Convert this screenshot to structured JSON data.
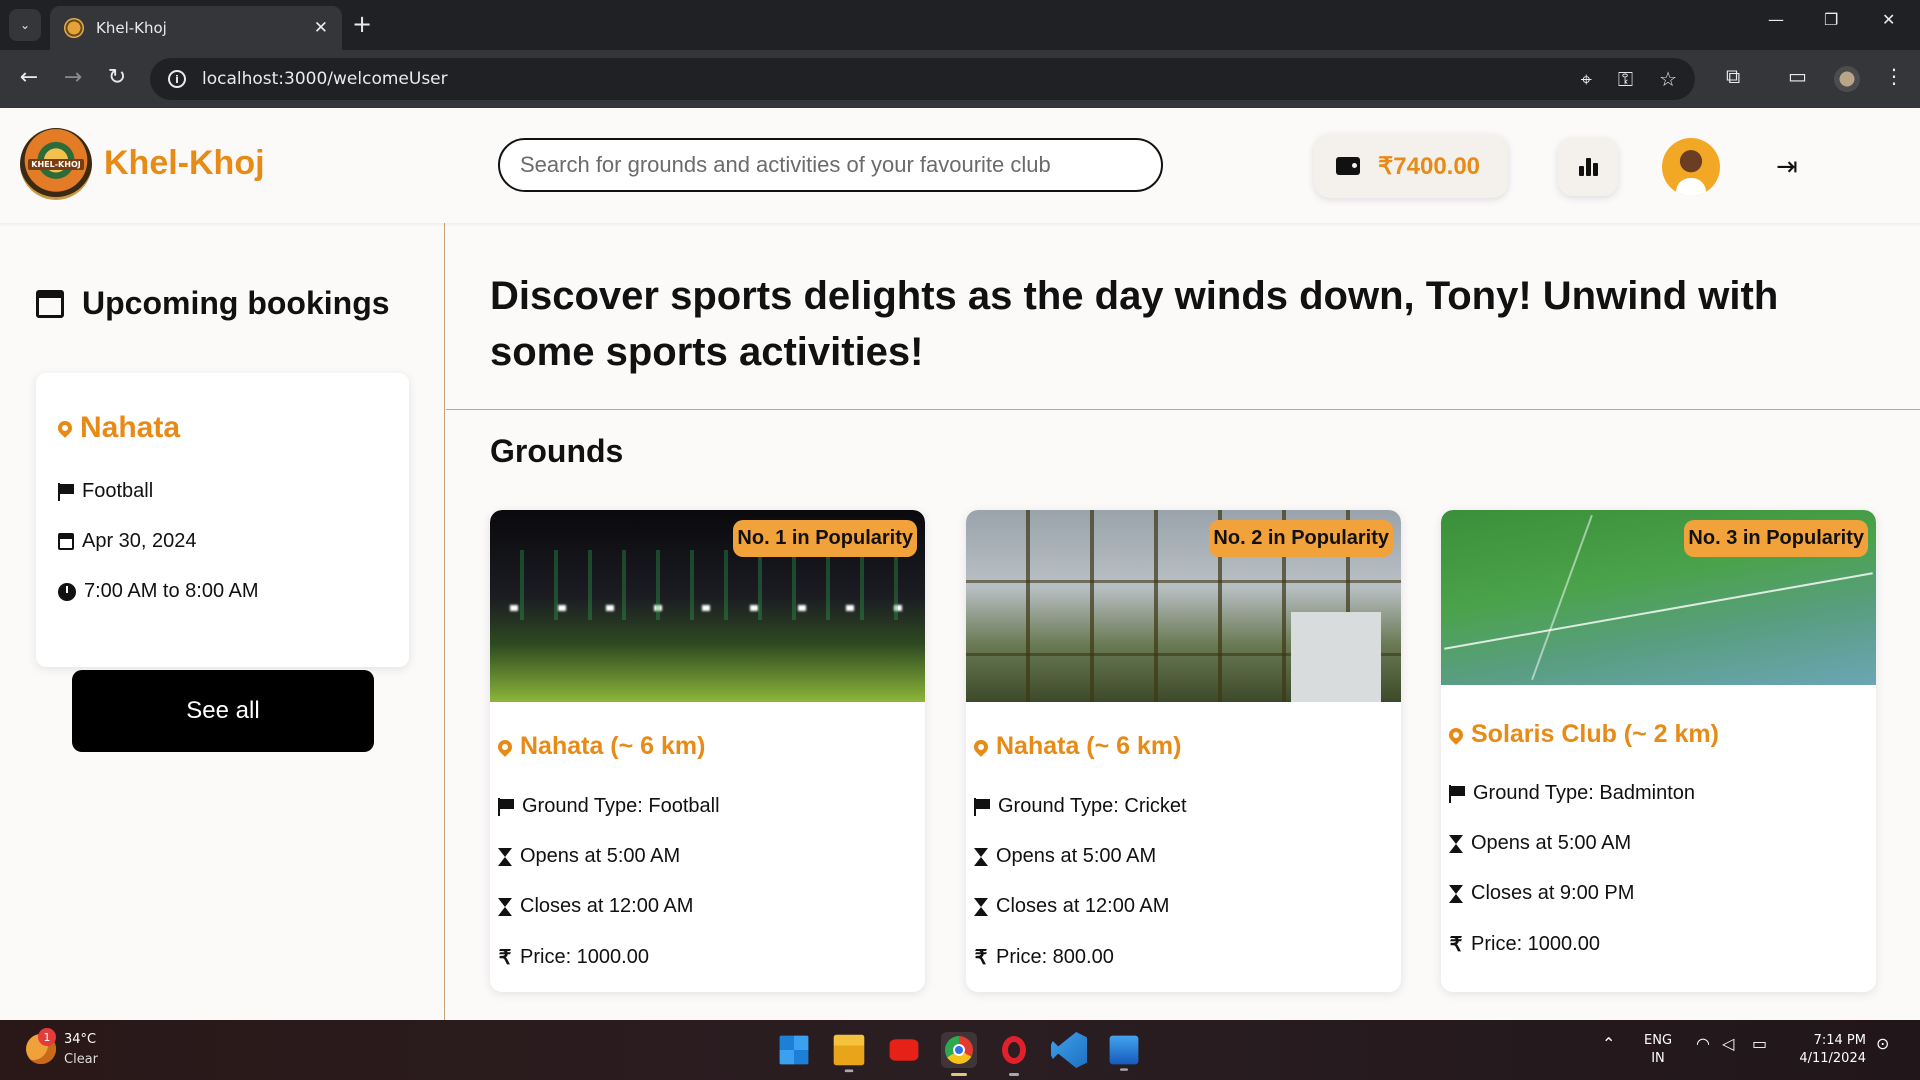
{
  "browser": {
    "tab_title": "Khel-Khoj",
    "url": "localhost:3000/welcomeUser"
  },
  "header": {
    "brand": "Khel-Khoj",
    "logo_text": "KHEL-KHOJ",
    "search_placeholder": "Search for grounds and activities of your favourite club",
    "wallet_amount": "₹7400.00",
    "accent_color": "#e88a16"
  },
  "sidebar": {
    "title": "Upcoming bookings",
    "booking": {
      "place": "Nahata",
      "sport": "Football",
      "date": "Apr 30, 2024",
      "time": "7:00 AM to 8:00 AM"
    },
    "see_all_label": "See all"
  },
  "main": {
    "headline": "Discover sports delights as the day winds down, Tony! Unwind with some sports activities!",
    "section_title": "Grounds",
    "grounds": [
      {
        "badge": "No. 1 in Popularity",
        "place": "Nahata (~ 6 km)",
        "type": "Ground Type: Football",
        "opens": "Opens at 5:00 AM",
        "closes": "Closes at 12:00 AM",
        "price": "Price: 1000.00"
      },
      {
        "badge": "No. 2 in Popularity",
        "place": "Nahata (~ 6 km)",
        "type": "Ground Type: Cricket",
        "opens": "Opens at 5:00 AM",
        "closes": "Closes at 12:00 AM",
        "price": "Price: 800.00"
      },
      {
        "badge": "No. 3 in Popularity",
        "place": "Solaris Club (~ 2 km)",
        "type": "Ground Type: Badminton",
        "opens": "Opens at 5:00 AM",
        "closes": "Closes at 9:00 PM",
        "price": "Price: 1000.00"
      }
    ]
  },
  "taskbar": {
    "weather_badge": "1",
    "temperature": "34°C",
    "condition": "Clear",
    "lang_top": "ENG",
    "lang_bottom": "IN",
    "time": "7:14 PM",
    "date": "4/11/2024"
  }
}
